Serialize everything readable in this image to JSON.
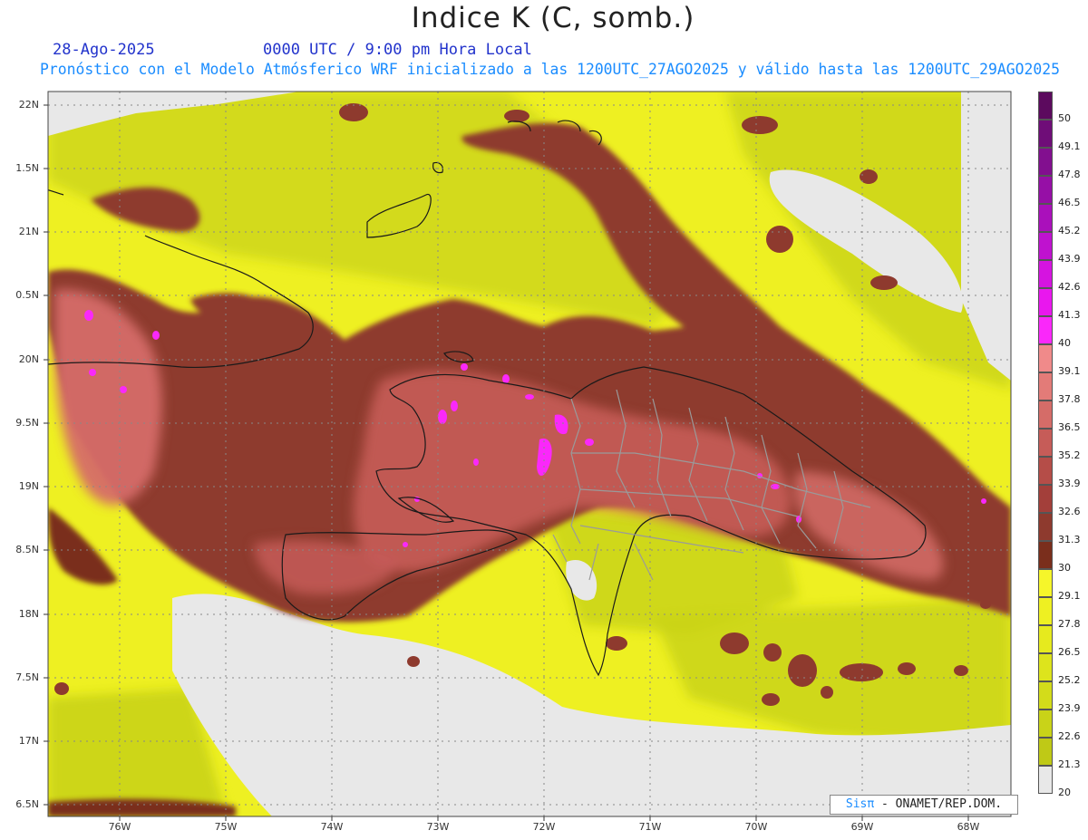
{
  "title": "Indice K (C, somb.)",
  "date": "28-Ago-2025",
  "time": "0000 UTC / 9:00 pm Hora Local",
  "forecast": "Pronóstico con el Modelo Atmósferico WRF inicializado a las 1200UTC_27AGO2025 y válido hasta las  1200UTC_29AGO2025",
  "credit": {
    "brand": "Sisπ",
    "rest": " - ONAMET/REP.DOM."
  },
  "lat_labels": [
    "22N",
    "1.5N",
    "21N",
    "0.5N",
    "20N",
    "9.5N",
    "19N",
    "8.5N",
    "18N",
    "7.5N",
    "17N",
    "6.5N"
  ],
  "lon_labels": [
    "76W",
    "75W",
    "74W",
    "73W",
    "72W",
    "71W",
    "70W",
    "69W",
    "68W"
  ],
  "colorbar": {
    "labels": [
      "50",
      "49.1",
      "47.8",
      "46.5",
      "45.2",
      "43.9",
      "42.6",
      "41.3",
      "40",
      "39.1",
      "37.8",
      "36.5",
      "35.2",
      "33.9",
      "32.6",
      "31.3",
      "30",
      "29.1",
      "27.8",
      "26.5",
      "25.2",
      "23.9",
      "22.6",
      "21.3",
      "20"
    ],
    "colors": [
      "#5c0a5e",
      "#6f0d78",
      "#820f8f",
      "#960fa6",
      "#aa10bb",
      "#bf12cf",
      "#d514e0",
      "#e917ee",
      "#fa28fa",
      "#f08a8a",
      "#e37b78",
      "#d56c68",
      "#c65c58",
      "#b54d48",
      "#a33f3a",
      "#8e3a2e",
      "#7a2e1c",
      "#f6f62a",
      "#eef022",
      "#e6ea1e",
      "#dde41c",
      "#d3dc1a",
      "#c9d318",
      "#bfc916",
      "#e8e8e8"
    ]
  }
}
